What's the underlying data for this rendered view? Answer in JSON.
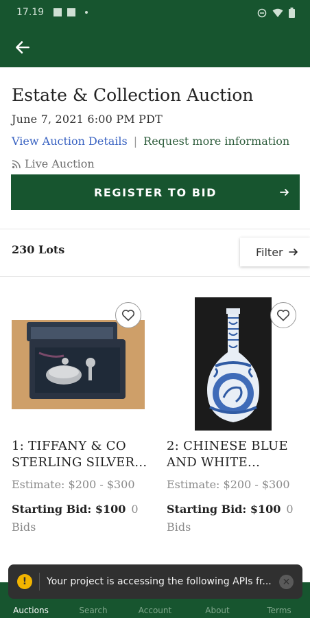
{
  "status_bar": {
    "time": "17.19",
    "icons_left": [
      "image-icon",
      "square-icon",
      "dot-icon"
    ],
    "icons_right": [
      "do-not-disturb-icon",
      "wifi-icon",
      "battery-icon"
    ]
  },
  "app_bar": {
    "back_icon": "arrow-left-icon"
  },
  "auction": {
    "title": "Estate & Collection Auction",
    "date": "June 7, 2021 6:00 PM PDT",
    "view_details": "View Auction Details",
    "separator": "|",
    "request_info": "Request more information",
    "live_label": "Live Auction",
    "live_icon": "rss-icon"
  },
  "register": {
    "label": "REGISTER TO BID",
    "icon": "arrow-right-icon"
  },
  "lots": {
    "count_label": "230 Lots",
    "filter_label": "Filter"
  },
  "items": [
    {
      "title_line1": "1: TIFFANY & CO",
      "title_line2": "STERLING SILVER...",
      "estimate": "Estimate: $200 - $300",
      "starting_bid": "Starting Bid: $100",
      "bid_count": "0",
      "bids_word": "Bids",
      "image_alt": "boxed silver flask set"
    },
    {
      "title_line1": "2: CHINESE BLUE",
      "title_line2": "AND WHITE...",
      "estimate": "Estimate: $200 - $300",
      "starting_bid": "Starting Bid: $100",
      "bid_count": "0",
      "bids_word": "Bids",
      "image_alt": "blue and white porcelain vase"
    }
  ],
  "toast": {
    "text": "Your project is accessing the following APIs fr...",
    "icon": "warning-icon",
    "close_icon": "close-icon"
  },
  "bottom_nav": [
    {
      "label": "Auctions",
      "active": true
    },
    {
      "label": "Search",
      "active": false
    },
    {
      "label": "Account",
      "active": false
    },
    {
      "label": "About",
      "active": false
    },
    {
      "label": "Terms",
      "active": false
    }
  ],
  "colors": {
    "brand_green": "#17552f",
    "link_blue": "#3a63c2",
    "link_green": "#2e5d3c",
    "toast_bg": "#303030",
    "warning": "#f2b400"
  }
}
